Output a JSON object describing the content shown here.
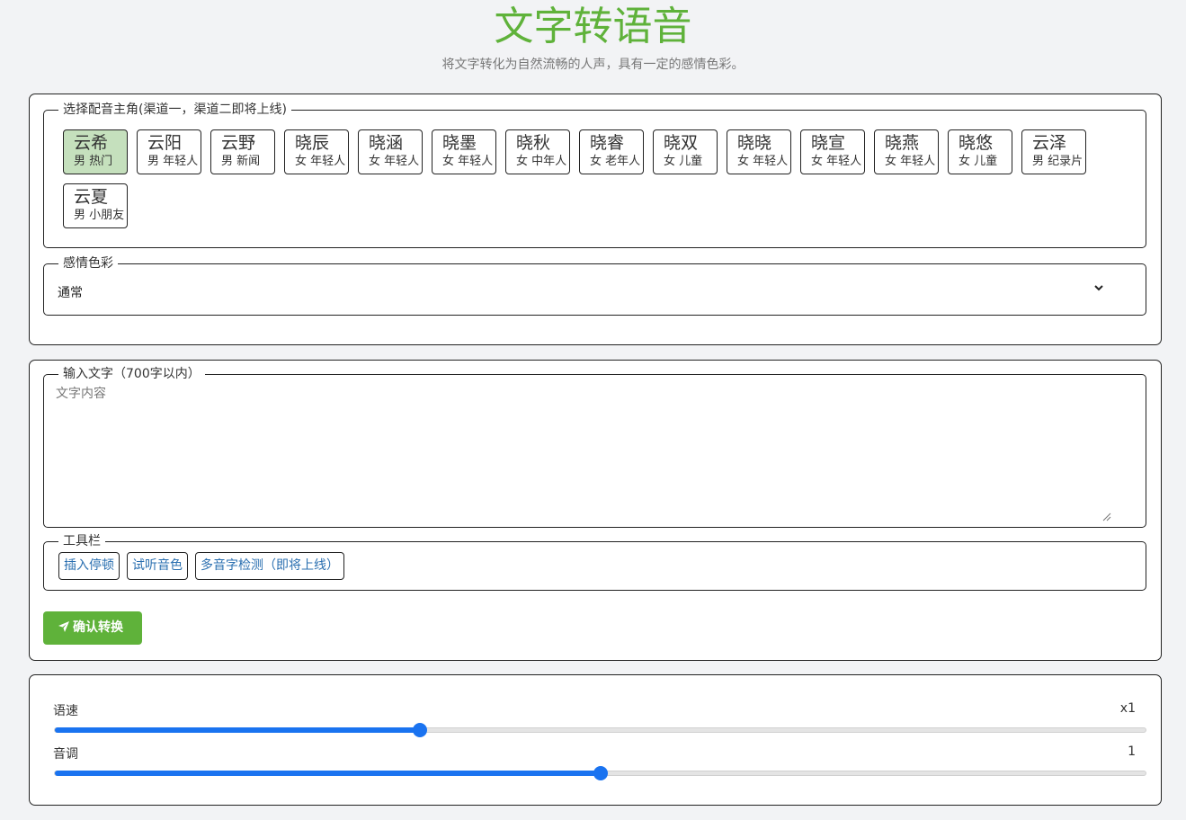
{
  "header": {
    "title": "文字转语音",
    "subtitle": "将文字转化为自然流畅的人声，具有一定的感情色彩。"
  },
  "voice_section": {
    "legend": "选择配音主角(渠道一，渠道二即将上线)",
    "voices": [
      {
        "name": "云希",
        "tag": "男 热门",
        "selected": true
      },
      {
        "name": "云阳",
        "tag": "男 年轻人"
      },
      {
        "name": "云野",
        "tag": "男 新闻"
      },
      {
        "name": "晓辰",
        "tag": "女 年轻人"
      },
      {
        "name": "晓涵",
        "tag": "女 年轻人"
      },
      {
        "name": "晓墨",
        "tag": "女 年轻人"
      },
      {
        "name": "晓秋",
        "tag": "女 中年人"
      },
      {
        "name": "晓睿",
        "tag": "女 老年人"
      },
      {
        "name": "晓双",
        "tag": "女 儿童"
      },
      {
        "name": "晓晓",
        "tag": "女 年轻人"
      },
      {
        "name": "晓宣",
        "tag": "女 年轻人"
      },
      {
        "name": "晓燕",
        "tag": "女 年轻人"
      },
      {
        "name": "晓悠",
        "tag": "女 儿童"
      },
      {
        "name": "云泽",
        "tag": "男 纪录片"
      },
      {
        "name": "云夏",
        "tag": "男 小朋友"
      }
    ]
  },
  "emotion": {
    "legend": "感情色彩",
    "value": "通常"
  },
  "input_section": {
    "legend": "输入文字（700字以内）",
    "placeholder": "文字内容"
  },
  "toolbar": {
    "legend": "工具栏",
    "buttons": [
      "插入停顿",
      "试听音色",
      "多音字检测（即将上线）"
    ]
  },
  "convert_button": "确认转换",
  "sliders": {
    "speed": {
      "label": "语速",
      "value_text": "x1",
      "fraction": 0.335
    },
    "pitch": {
      "label": "音调",
      "value_text": "1",
      "fraction": 0.5
    }
  },
  "colors": {
    "accent_green": "#5fb23a",
    "slider_blue": "#1a73f0",
    "selected_voice_bg": "#c5e0bd"
  }
}
